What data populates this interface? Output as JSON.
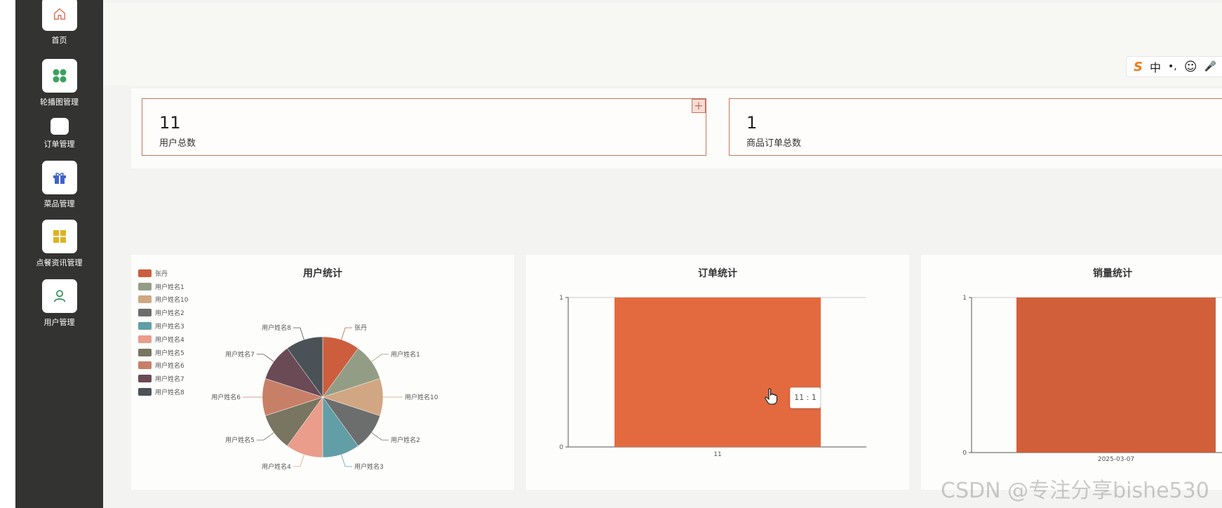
{
  "sidebar": {
    "items": [
      {
        "label": "首页",
        "icon": "home-icon"
      },
      {
        "label": "轮播图管理",
        "icon": "clover-icon"
      },
      {
        "label": "订单管理",
        "icon": "blank-icon"
      },
      {
        "label": "菜品管理",
        "icon": "gift-icon"
      },
      {
        "label": "点餐资讯管理",
        "icon": "grid-icon"
      },
      {
        "label": "用户管理",
        "icon": "user-icon"
      }
    ]
  },
  "ime_toolbar": {
    "logo": "S",
    "lang": "中",
    "punct": "•,",
    "emoji": "☺",
    "mic": "🎤"
  },
  "stats": [
    {
      "value": "11",
      "label": "用户总数"
    },
    {
      "value": "1",
      "label": "商品订单总数"
    }
  ],
  "plus_symbol": "+",
  "chart_data": [
    {
      "type": "pie",
      "title": "用户统计",
      "legend_position": "top-left",
      "labels": [
        "张丹",
        "用户姓名1",
        "用户姓名10",
        "用户姓名2",
        "用户姓名3",
        "用户姓名4",
        "用户姓名5",
        "用户姓名6",
        "用户姓名7",
        "用户姓名8"
      ],
      "values": [
        1,
        1,
        1,
        1,
        1,
        1,
        1,
        1,
        1,
        1
      ],
      "colors": [
        "#cc5e3e",
        "#939d86",
        "#d1a682",
        "#6c6e6d",
        "#619ea6",
        "#e99d8a",
        "#787560",
        "#c87f68",
        "#6a4a55",
        "#4a5257"
      ]
    },
    {
      "type": "bar",
      "title": "订单统计",
      "categories": [
        "11"
      ],
      "values": [
        1
      ],
      "ylim": [
        0,
        1
      ],
      "yticks": [
        "0",
        "1"
      ],
      "color": "#e36a3f",
      "tooltip": "11 : 1"
    },
    {
      "type": "bar",
      "title": "销量统计",
      "categories": [
        "2025-03-07"
      ],
      "values": [
        1
      ],
      "ylim": [
        0,
        1
      ],
      "yticks": [
        "0",
        "1"
      ],
      "color": "#d1603a"
    }
  ],
  "watermark": "CSDN @专注分享bishe530"
}
